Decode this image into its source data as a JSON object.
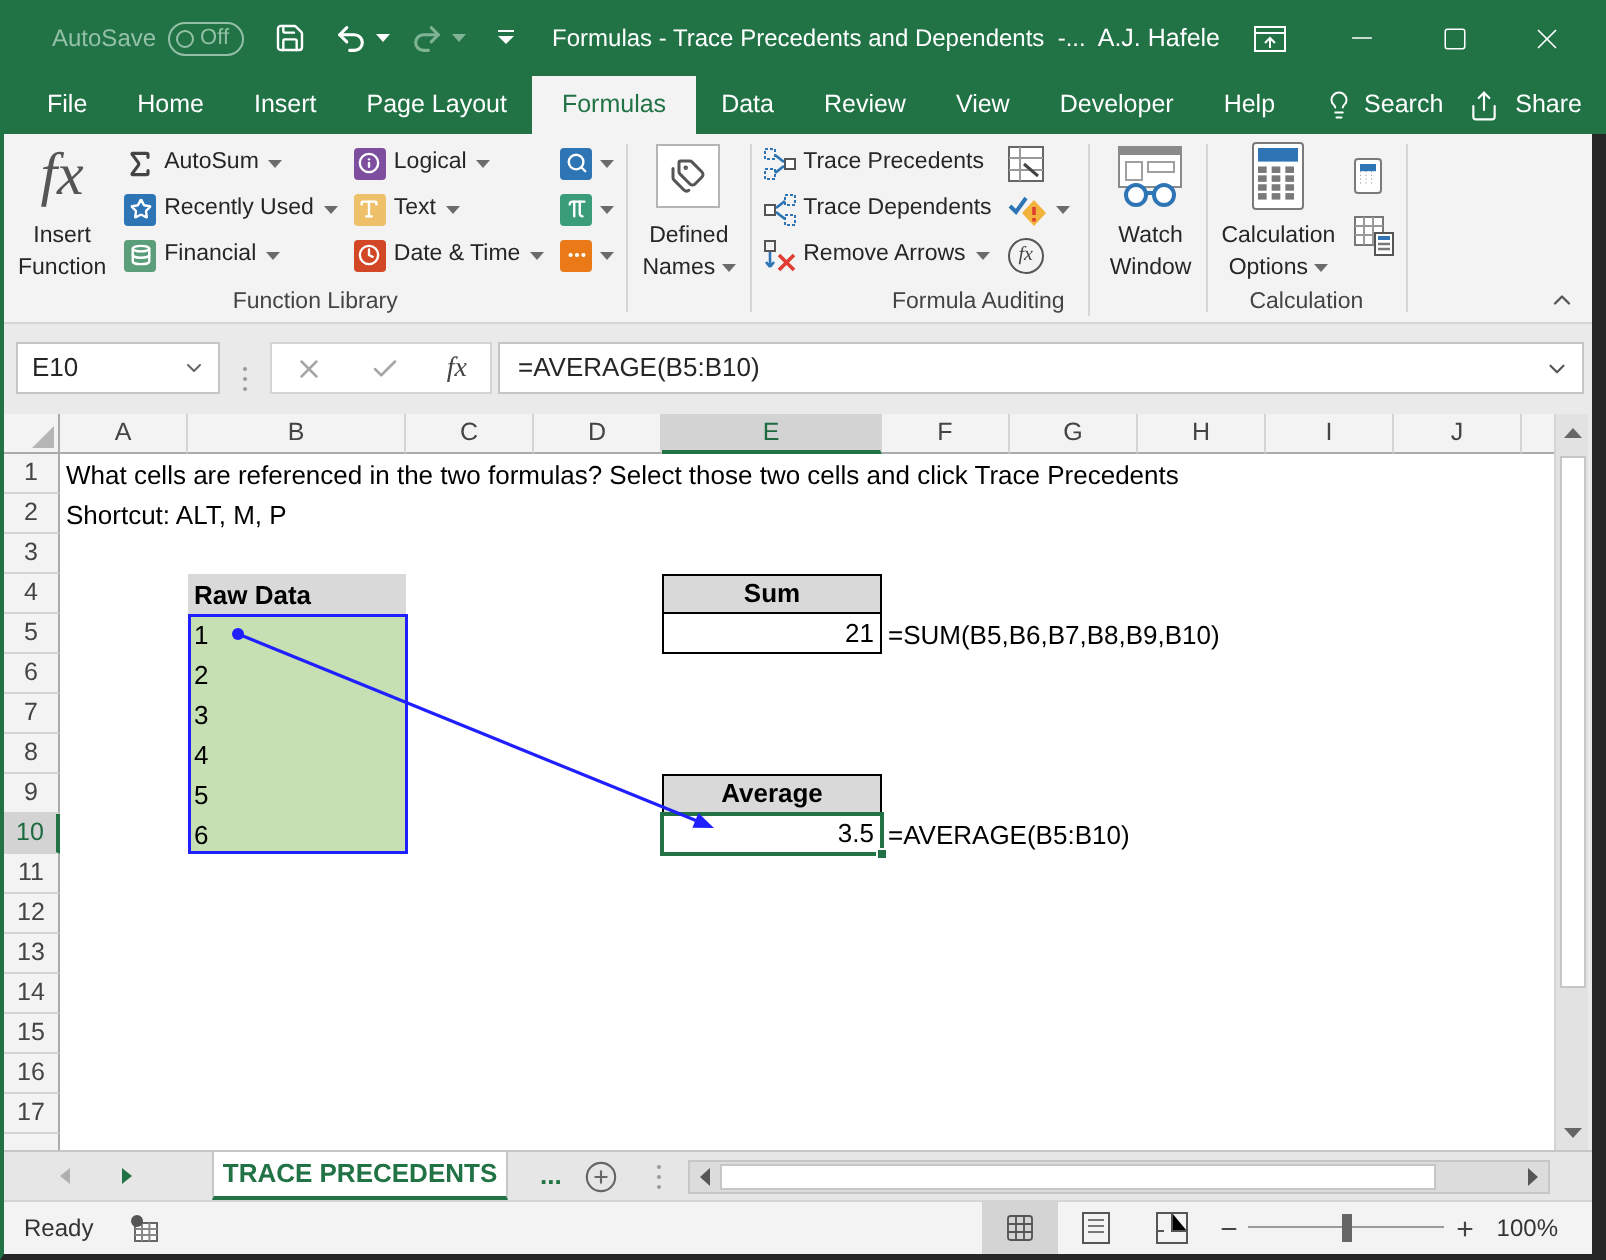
{
  "title_bar": {
    "autosave": {
      "label": "AutoSave",
      "state": "Off",
      "on": false
    },
    "title": "Formulas - Trace Precedents and Dependents  -...",
    "user": "A.J. Hafele"
  },
  "ribbon_tabs": [
    {
      "label": "File",
      "selected": false
    },
    {
      "label": "Home",
      "selected": false
    },
    {
      "label": "Insert",
      "selected": false
    },
    {
      "label": "Page Layout",
      "selected": false
    },
    {
      "label": "Formulas",
      "selected": true
    },
    {
      "label": "Data",
      "selected": false
    },
    {
      "label": "Review",
      "selected": false
    },
    {
      "label": "View",
      "selected": false
    },
    {
      "label": "Developer",
      "selected": false
    },
    {
      "label": "Help",
      "selected": false
    }
  ],
  "tell_me": {
    "label": "Search"
  },
  "share": {
    "label": "Share"
  },
  "ribbon_groups": [
    {
      "label": "Function Library",
      "columns": [
        {
          "kind": "large",
          "buttons": [
            {
              "label": "Insert Function",
              "icon_text": "fx",
              "dropdown": false
            }
          ]
        },
        {
          "kind": "small",
          "buttons": [
            {
              "label": "AutoSum",
              "dropdown": true
            },
            {
              "label": "Recently Used",
              "dropdown": true
            },
            {
              "label": "Financial",
              "dropdown": true
            }
          ]
        },
        {
          "kind": "small",
          "buttons": [
            {
              "label": "Logical",
              "dropdown": true
            },
            {
              "label": "Text",
              "dropdown": true
            },
            {
              "label": "Date & Time",
              "dropdown": true
            }
          ]
        },
        {
          "kind": "icon",
          "buttons": [
            {
              "dropdown": true
            },
            {
              "dropdown": true
            },
            {
              "dropdown": true
            }
          ]
        }
      ]
    },
    {
      "columns": [
        {
          "kind": "large",
          "buttons": [
            {
              "label": "Defined Names",
              "dropdown": true
            }
          ]
        }
      ]
    },
    {
      "label": "Formula Auditing",
      "columns": [
        {
          "kind": "small",
          "buttons": [
            {
              "label": "Trace Precedents",
              "dropdown": false
            },
            {
              "label": "Trace Dependents",
              "dropdown": false
            },
            {
              "label": "Remove Arrows",
              "dropdown": true
            }
          ]
        },
        {
          "kind": "icon",
          "buttons": [
            {
              "dropdown": false
            },
            {
              "dropdown": true
            },
            {
              "icon_text": "fx",
              "dropdown": false
            }
          ]
        },
        {
          "kind": "separator"
        },
        {
          "kind": "large",
          "buttons": [
            {
              "label": "Watch Window",
              "dropdown": false
            }
          ]
        }
      ]
    },
    {
      "label": "Calculation",
      "columns": [
        {
          "kind": "large",
          "buttons": [
            {
              "label": "Calculation Options",
              "dropdown": true
            }
          ]
        },
        {
          "kind": "icon",
          "buttons": [
            {
              "dropdown": false
            },
            {
              "dropdown": false
            }
          ]
        }
      ]
    }
  ],
  "formula_bar": {
    "name_box": "E10",
    "insert_function": "fx",
    "formula": "=AVERAGE(B5:B10)"
  },
  "sheet": {
    "columns": [
      {
        "label": "A",
        "selected": false
      },
      {
        "label": "B",
        "selected": false
      },
      {
        "label": "C",
        "selected": false
      },
      {
        "label": "D",
        "selected": false
      },
      {
        "label": "E",
        "selected": true
      },
      {
        "label": "F",
        "selected": false
      },
      {
        "label": "G",
        "selected": false
      },
      {
        "label": "H",
        "selected": false
      },
      {
        "label": "I",
        "selected": false
      },
      {
        "label": "J",
        "selected": false
      }
    ],
    "rows": [
      {
        "label": "1",
        "selected": false,
        "cells": [
          {
            "kind": "text",
            "text": "What cells are referenced in the two formulas? Select those two cells and click Trace Precedents",
            "selected": false
          }
        ]
      },
      {
        "label": "2",
        "selected": false,
        "cells": [
          {
            "kind": "text",
            "text": "Shortcut: ALT, M, P",
            "selected": false
          }
        ]
      },
      {
        "label": "3",
        "selected": false
      },
      {
        "label": "4",
        "selected": false,
        "cells": [
          null,
          {
            "kind": "caption",
            "text": "Raw Data",
            "selected": false
          },
          null,
          null,
          {
            "kind": "heading",
            "text": "Sum",
            "selected": false
          }
        ]
      },
      {
        "label": "5",
        "selected": false,
        "cells": [
          null,
          {
            "kind": "data",
            "text": "1",
            "selected": false
          },
          null,
          null,
          {
            "kind": "total",
            "text": "21",
            "selected": false
          },
          {
            "kind": "text",
            "text": "=SUM(B5,B6,B7,B8,B9,B10)",
            "selected": false
          }
        ]
      },
      {
        "label": "6",
        "selected": false,
        "cells": [
          null,
          {
            "kind": "data",
            "text": "2",
            "selected": false
          }
        ]
      },
      {
        "label": "7",
        "selected": false,
        "cells": [
          null,
          {
            "kind": "data",
            "text": "3",
            "selected": false
          }
        ]
      },
      {
        "label": "8",
        "selected": false,
        "cells": [
          null,
          {
            "kind": "data",
            "text": "4",
            "selected": false
          }
        ]
      },
      {
        "label": "9",
        "selected": false,
        "cells": [
          null,
          {
            "kind": "data",
            "text": "5",
            "selected": false
          },
          null,
          null,
          {
            "kind": "heading",
            "text": "Average",
            "selected": false
          }
        ]
      },
      {
        "label": "10",
        "selected": true,
        "cells": [
          null,
          {
            "kind": "data",
            "text": "6",
            "selected": false
          },
          null,
          null,
          {
            "kind": "total",
            "text": "3.5",
            "selected": true
          },
          {
            "kind": "text",
            "text": "=AVERAGE(B5:B10)",
            "selected": false
          }
        ]
      },
      {
        "label": "11",
        "selected": false
      },
      {
        "label": "12",
        "selected": false
      },
      {
        "label": "13",
        "selected": false
      },
      {
        "label": "14",
        "selected": false
      },
      {
        "label": "15",
        "selected": false
      },
      {
        "label": "16",
        "selected": false
      },
      {
        "label": "17",
        "selected": false
      }
    ],
    "trace_arrows_shown": true
  },
  "sheet_tabs": {
    "tabs": [
      {
        "label": "TRACE PRECEDENTS",
        "selected": true
      }
    ],
    "more": "..."
  },
  "status_bar": {
    "status": "Ready",
    "views": [
      {
        "selected": true
      },
      {
        "selected": false
      },
      {
        "selected": false
      }
    ],
    "zoom": {
      "level": 0.5,
      "label": "100%"
    }
  }
}
